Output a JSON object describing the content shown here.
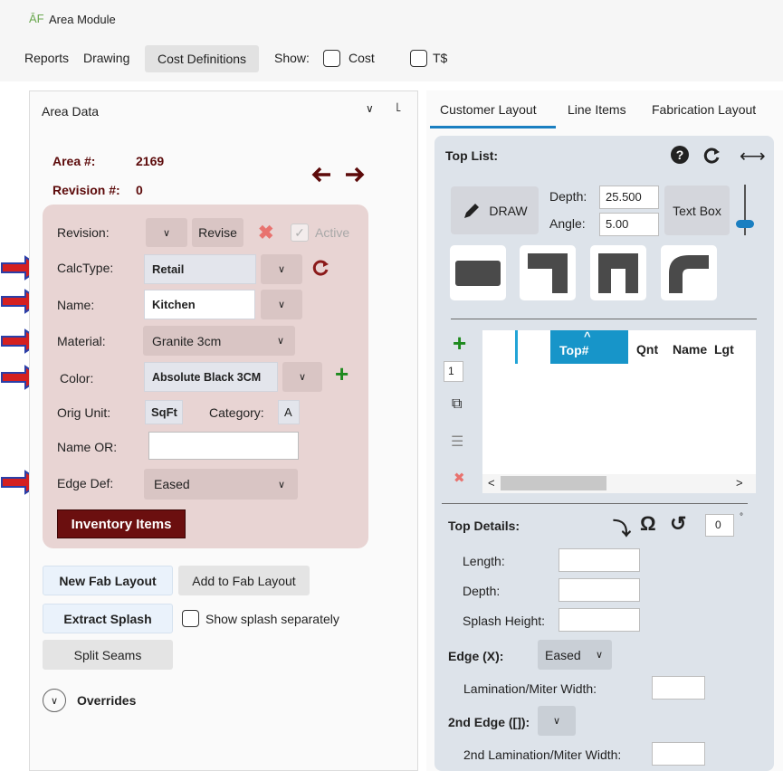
{
  "window": {
    "title": "Area Module",
    "logo": "ĀF"
  },
  "menu": {
    "reports": "Reports",
    "drawing": "Drawing",
    "cost_definitions": "Cost Definitions",
    "show_label": "Show:",
    "cost_label": "Cost",
    "t_label": "T$"
  },
  "area_panel": {
    "header": "Area Data",
    "area_label": "Area #:",
    "area_value": "2169",
    "revision_label": "Revision #:",
    "revision_value": "0",
    "form": {
      "revision_label": "Revision:",
      "revise_button": "Revise",
      "active_label": "Active",
      "calctype_label": "CalcType:",
      "calctype_value": "Retail",
      "name_label": "Name:",
      "name_value": "Kitchen",
      "material_label": "Material:",
      "material_value": "Granite 3cm",
      "color_label": "Color:",
      "color_value": "Absolute Black 3CM",
      "orig_unit_label": "Orig Unit:",
      "orig_unit_value": "SqFt",
      "category_label": "Category:",
      "category_value": "A",
      "name_or_label": "Name OR:",
      "name_or_value": "",
      "edge_def_label": "Edge Def:",
      "edge_def_value": "Eased",
      "inventory_button": "Inventory Items"
    },
    "new_fab_layout": "New Fab Layout",
    "add_to_fab_layout": "Add to Fab Layout",
    "extract_splash": "Extract Splash",
    "show_splash_label": "Show splash separately",
    "split_seams": "Split Seams",
    "overrides": "Overrides"
  },
  "right_panel": {
    "tabs": [
      "Customer Layout",
      "Line Items",
      "Fabrication Layout"
    ],
    "top_list": "Top List:",
    "draw_button": "DRAW",
    "depth_label": "Depth:",
    "depth_value": "25.500",
    "angle_label": "Angle:",
    "angle_value": "5.00",
    "text_box": "Text Box",
    "grid_headers": [
      "Top#",
      "Qnt",
      "Name",
      "Lgt"
    ],
    "qty_value": "1",
    "top_details": "Top Details:",
    "rotation_value": "0",
    "length_label": "Length:",
    "depth2_label": "Depth:",
    "splash_height_label": "Splash Height:",
    "edge_label": "Edge (X):",
    "edge_value": "Eased",
    "lamination_label": "Lamination/Miter Width:",
    "second_edge_label": "2nd Edge ([]):",
    "second_lamination_label": "2nd Lamination/Miter Width:"
  },
  "colors": {
    "accent": "#1a7fc1",
    "maroon": "#5c0a0a",
    "pink_bg": "#e8d4d3",
    "green": "#1e8a1e",
    "red_x": "#e8736f",
    "arrow_red": "#d42020",
    "arrow_blue": "#2a3fa8"
  }
}
